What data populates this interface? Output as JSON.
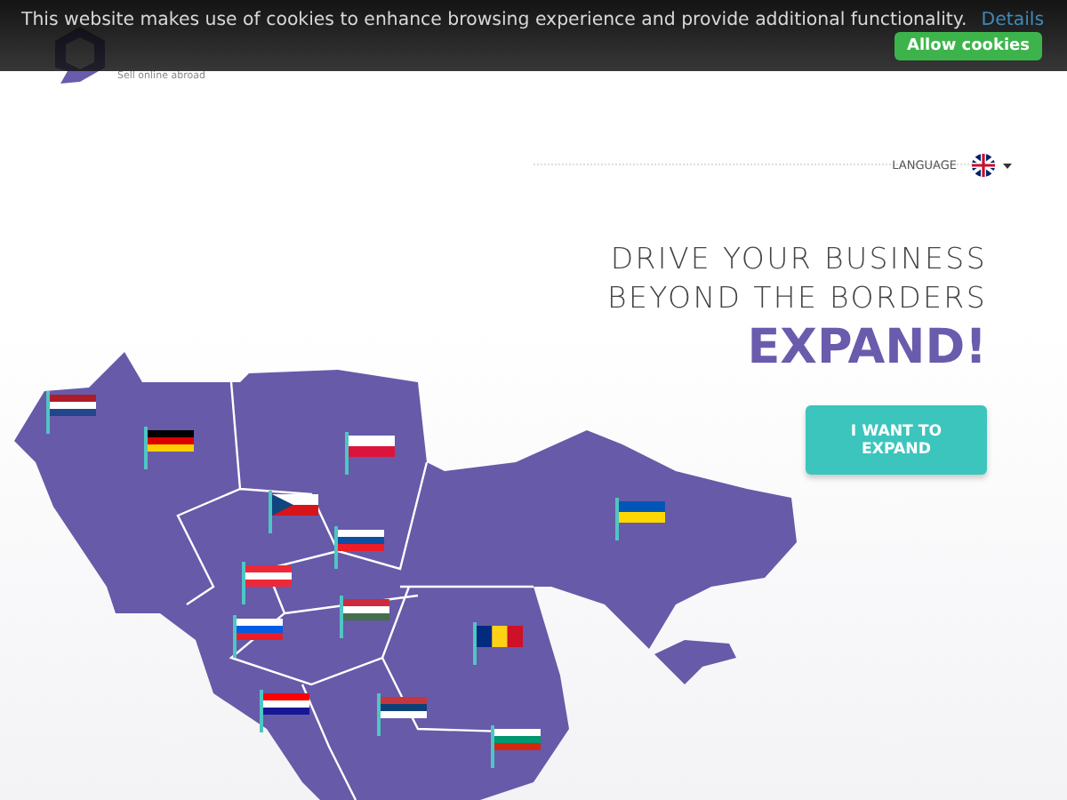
{
  "cookie_bar": {
    "message": "This website makes use of cookies to enhance browsing experience and provide additional functionality.",
    "link": "Details",
    "button": "Allow cookies"
  },
  "header": {
    "tagline": "Sell online abroad"
  },
  "language": {
    "label": "LANGUAGE"
  },
  "hero": {
    "headline": "DRIVE YOUR BUSINESS BEYOND THE BORDERS",
    "emphasis": "EXPAND!",
    "button": "I WANT TO EXPAND"
  }
}
